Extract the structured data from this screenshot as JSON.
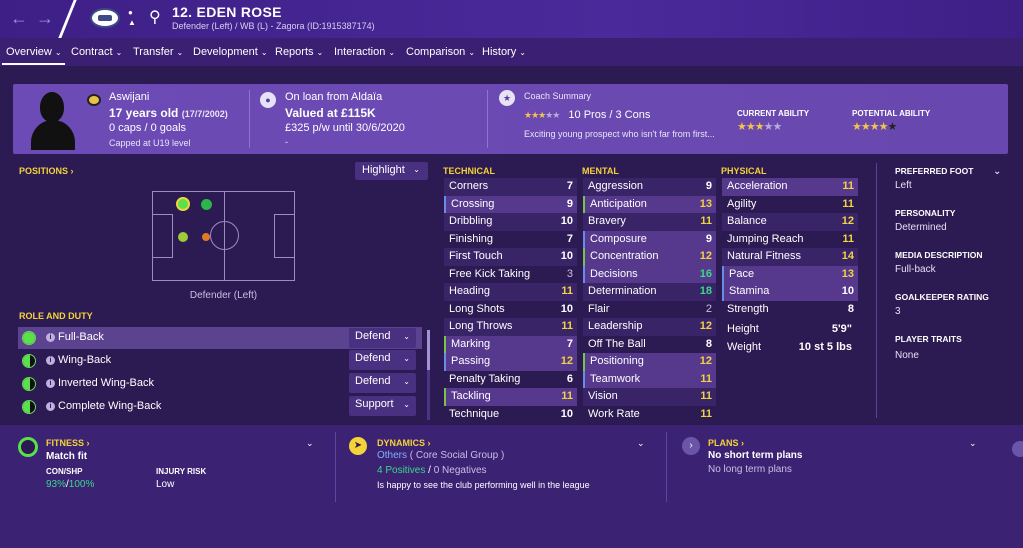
{
  "player": {
    "name": "12. EDEN ROSE",
    "subtitle": "Defender (Left) / WB (L) - Zagora (ID:1915387174)"
  },
  "tabs": [
    {
      "label": "Overview"
    },
    {
      "label": "Contract"
    },
    {
      "label": "Transfer"
    },
    {
      "label": "Development"
    },
    {
      "label": "Reports"
    },
    {
      "label": "Interaction"
    },
    {
      "label": "Comparison"
    },
    {
      "label": "History"
    }
  ],
  "header": {
    "nationality": "Aswijani",
    "age": "17 years old",
    "dob": "(17/7/2002)",
    "caps": "0 caps / 0 goals",
    "capped": "Capped at U19 level",
    "loan": "On loan from Aldaïa",
    "value": "Valued at £115K",
    "wage": "£325 p/w until 30/6/2020",
    "wage_extra": "-",
    "coach_title": "Coach Summary",
    "coach_pros_cons": "10 Pros / 3 Cons",
    "coach_text": "Exciting young prospect who isn't far from first...",
    "current_ability_label": "CURRENT ABILITY",
    "potential_ability_label": "POTENTIAL ABILITY",
    "current_ability_stars": 3,
    "potential_ability_stars": 4.5,
    "coach_stars": 3
  },
  "positions": {
    "title": "POSITIONS",
    "highlight_label": "Highlight",
    "pitch_label": "Defender (Left)",
    "role_title": "ROLE AND DUTY"
  },
  "roles": [
    {
      "name": "Full-Back",
      "duty": "Defend",
      "suitability": 1.0
    },
    {
      "name": "Wing-Back",
      "duty": "Defend",
      "suitability": 0.5
    },
    {
      "name": "Inverted Wing-Back",
      "duty": "Defend",
      "suitability": 0.5
    },
    {
      "name": "Complete Wing-Back",
      "duty": "Support",
      "suitability": 0.5
    }
  ],
  "technical": {
    "title": "TECHNICAL",
    "items": [
      {
        "name": "Corners",
        "value": "7"
      },
      {
        "name": "Crossing",
        "value": "9"
      },
      {
        "name": "Dribbling",
        "value": "10"
      },
      {
        "name": "Finishing",
        "value": "7"
      },
      {
        "name": "First Touch",
        "value": "10"
      },
      {
        "name": "Free Kick Taking",
        "value": "3"
      },
      {
        "name": "Heading",
        "value": "11"
      },
      {
        "name": "Long Shots",
        "value": "10"
      },
      {
        "name": "Long Throws",
        "value": "11"
      },
      {
        "name": "Marking",
        "value": "7"
      },
      {
        "name": "Passing",
        "value": "12"
      },
      {
        "name": "Penalty Taking",
        "value": "6"
      },
      {
        "name": "Tackling",
        "value": "11"
      },
      {
        "name": "Technique",
        "value": "10"
      }
    ]
  },
  "mental": {
    "title": "MENTAL",
    "items": [
      {
        "name": "Aggression",
        "value": "9"
      },
      {
        "name": "Anticipation",
        "value": "13"
      },
      {
        "name": "Bravery",
        "value": "11"
      },
      {
        "name": "Composure",
        "value": "9"
      },
      {
        "name": "Concentration",
        "value": "12"
      },
      {
        "name": "Decisions",
        "value": "16"
      },
      {
        "name": "Determination",
        "value": "18"
      },
      {
        "name": "Flair",
        "value": "2"
      },
      {
        "name": "Leadership",
        "value": "12"
      },
      {
        "name": "Off The Ball",
        "value": "8"
      },
      {
        "name": "Positioning",
        "value": "12"
      },
      {
        "name": "Teamwork",
        "value": "11"
      },
      {
        "name": "Vision",
        "value": "11"
      },
      {
        "name": "Work Rate",
        "value": "11"
      }
    ]
  },
  "physical": {
    "title": "PHYSICAL",
    "items": [
      {
        "name": "Acceleration",
        "value": "11"
      },
      {
        "name": "Agility",
        "value": "11"
      },
      {
        "name": "Balance",
        "value": "12"
      },
      {
        "name": "Jumping Reach",
        "value": "11"
      },
      {
        "name": "Natural Fitness",
        "value": "14"
      },
      {
        "name": "Pace",
        "value": "13"
      },
      {
        "name": "Stamina",
        "value": "10"
      },
      {
        "name": "Strength",
        "value": "8"
      }
    ],
    "height_label": "Height",
    "height": "5'9\"",
    "weight_label": "Weight",
    "weight": "10 st 5 lbs"
  },
  "info": {
    "preferred_foot_label": "PREFERRED FOOT",
    "preferred_foot": "Left",
    "personality_label": "PERSONALITY",
    "personality": "Determined",
    "media_label": "MEDIA DESCRIPTION",
    "media": "Full-back",
    "gk_label": "GOALKEEPER RATING",
    "gk": "3",
    "traits_label": "PLAYER TRAITS",
    "traits": "None"
  },
  "fitness": {
    "title": "FITNESS",
    "status": "Match fit",
    "con_label": "CON/SHP",
    "con_value": "93%",
    "shp_value": "100%",
    "injury_label": "INJURY RISK",
    "injury_value": "Low"
  },
  "dynamics": {
    "title": "DYNAMICS",
    "group": "Others",
    "group_detail": "( Core Social Group )",
    "positives": "4 Positives",
    "negatives": "0 Negatives",
    "note": "Is happy to see the club performing well in the league"
  },
  "plans": {
    "title": "PLANS",
    "short": "No short term plans",
    "long": "No long term plans"
  },
  "colors": {
    "good": "#f0d341",
    "great": "#39d98a",
    "accent": "#4a2a9a"
  }
}
